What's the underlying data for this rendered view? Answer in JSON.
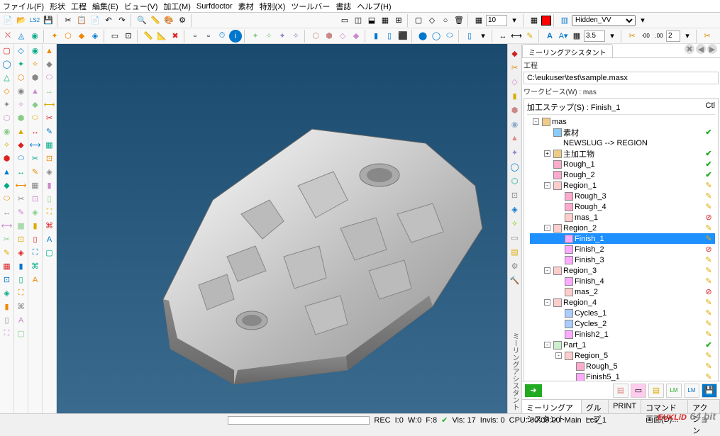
{
  "menu": [
    "ファイル(F)",
    "形状",
    "工程",
    "編集(E)",
    "ビュー(V)",
    "加工(M)",
    "Surfdoctor",
    "素材",
    "特別(X)",
    "ツールバー",
    "書誌",
    "ヘルプ(H)"
  ],
  "toolbar1": {
    "num": "10",
    "dropdown": "Hidden_VV"
  },
  "toolbar2": {
    "num": "3.5",
    "num2": "2"
  },
  "rightstrip_label": "ミーリングアシスタント",
  "panel": {
    "tab": "ミーリングアシスタント",
    "section_proc": "工程",
    "filepath": "C:\\eukuser\\test\\sample.masx",
    "section_wp": "ワークピース(W) : mas",
    "section_step": "加工ステップ(S) : Finish_1",
    "col_ctl": "Ctl",
    "tree": [
      {
        "d": 0,
        "exp": "-",
        "ico": "#ec8",
        "t": "mas",
        "st": ""
      },
      {
        "d": 1,
        "exp": "",
        "ico": "#8cf",
        "t": "素材",
        "st": "chk"
      },
      {
        "d": 1,
        "exp": "",
        "ico": "",
        "t": "NEWSLUG --> REGION",
        "st": ""
      },
      {
        "d": 1,
        "exp": "+",
        "ico": "#ec8",
        "t": "主加工物",
        "st": "chk"
      },
      {
        "d": 1,
        "exp": "",
        "ico": "#fac",
        "t": "Rough_1",
        "st": "chk"
      },
      {
        "d": 1,
        "exp": "",
        "ico": "#fac",
        "t": "Rough_2",
        "st": "chk"
      },
      {
        "d": 1,
        "exp": "-",
        "ico": "#fcc",
        "t": "Region_1",
        "st": "pen"
      },
      {
        "d": 2,
        "exp": "",
        "ico": "#fac",
        "t": "Rough_3",
        "st": "pen"
      },
      {
        "d": 2,
        "exp": "",
        "ico": "#fac",
        "t": "Rough_4",
        "st": "pen"
      },
      {
        "d": 2,
        "exp": "",
        "ico": "#fcc",
        "t": "mas_1",
        "st": "stop"
      },
      {
        "d": 1,
        "exp": "-",
        "ico": "#fcc",
        "t": "Region_2",
        "st": "pen"
      },
      {
        "d": 2,
        "exp": "",
        "ico": "#faf",
        "t": "Finish_1",
        "st": "pen",
        "sel": true
      },
      {
        "d": 2,
        "exp": "",
        "ico": "#faf",
        "t": "Finish_2",
        "st": "stop"
      },
      {
        "d": 2,
        "exp": "",
        "ico": "#faf",
        "t": "Finish_3",
        "st": "pen"
      },
      {
        "d": 1,
        "exp": "-",
        "ico": "#fcc",
        "t": "Region_3",
        "st": "pen"
      },
      {
        "d": 2,
        "exp": "",
        "ico": "#faf",
        "t": "Finish_4",
        "st": "pen"
      },
      {
        "d": 2,
        "exp": "",
        "ico": "#fcc",
        "t": "mas_2",
        "st": "stop"
      },
      {
        "d": 1,
        "exp": "-",
        "ico": "#fcc",
        "t": "Region_4",
        "st": "pen"
      },
      {
        "d": 2,
        "exp": "",
        "ico": "#acf",
        "t": "Cycles_1",
        "st": "pen"
      },
      {
        "d": 2,
        "exp": "",
        "ico": "#acf",
        "t": "Cycles_2",
        "st": "pen"
      },
      {
        "d": 2,
        "exp": "",
        "ico": "#faf",
        "t": "Finish2_1",
        "st": "pen"
      },
      {
        "d": 1,
        "exp": "-",
        "ico": "#cec",
        "t": "Part_1",
        "st": "chk"
      },
      {
        "d": 2,
        "exp": "-",
        "ico": "#fcc",
        "t": "Region_5",
        "st": "pen"
      },
      {
        "d": 3,
        "exp": "",
        "ico": "#fac",
        "t": "Rough_5",
        "st": "pen"
      },
      {
        "d": 3,
        "exp": "",
        "ico": "#faf",
        "t": "Finish5_1",
        "st": "pen"
      }
    ],
    "bottom_tabs": [
      "ミーリングアシスタント",
      "グループ",
      "PRINT",
      "コマンド画面(D)...",
      "アクション"
    ]
  },
  "status": {
    "rec": "REC",
    "i": "I:0",
    "w": "W:0",
    "f": "F:8",
    "vis": "Vis: 17",
    "invis": "Invis: 0",
    "cpu": "CPU: 00:00:00",
    "main": "Main",
    "lcs": "Lcs_1"
  },
  "logo": "EUKLiD",
  "logobits": "64 bit"
}
